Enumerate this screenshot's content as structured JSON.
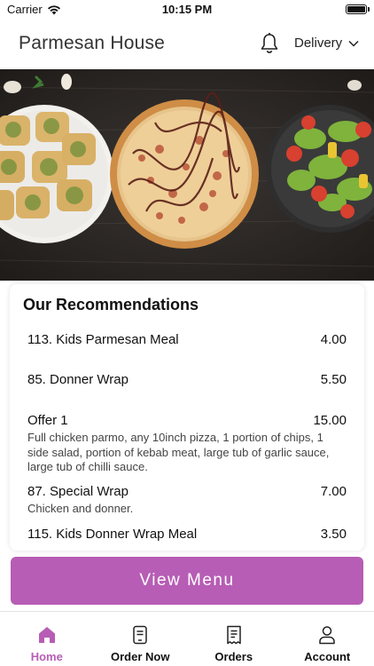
{
  "status_bar": {
    "carrier": "Carrier",
    "time": "10:15 PM"
  },
  "header": {
    "title": "Parmesan House",
    "delivery_label": "Delivery"
  },
  "recommendations": {
    "title": "Our Recommendations",
    "items": [
      {
        "name": "113. Kids Parmesan Meal",
        "price": "4.00",
        "description": ""
      },
      {
        "name": "85. Donner Wrap",
        "price": "5.50",
        "description": ""
      },
      {
        "name": "Offer 1",
        "price": "15.00",
        "description": "Full chicken parmo, any 10inch pizza, 1 portion of chips, 1 side salad, portion of kebab meat, large tub of garlic sauce, large tub of chilli sauce."
      },
      {
        "name": "87. Special Wrap",
        "price": "7.00",
        "description": "Chicken and donner."
      },
      {
        "name": "115. Kids Donner Wrap Meal",
        "price": "3.50",
        "description": ""
      }
    ]
  },
  "view_menu_label": "View Menu",
  "tabs": [
    {
      "label": "Home",
      "icon": "home-icon",
      "active": true
    },
    {
      "label": "Order Now",
      "icon": "order-icon",
      "active": false
    },
    {
      "label": "Orders",
      "icon": "receipt-icon",
      "active": false
    },
    {
      "label": "Account",
      "icon": "account-icon",
      "active": false
    }
  ],
  "colors": {
    "accent": "#b75db5"
  }
}
